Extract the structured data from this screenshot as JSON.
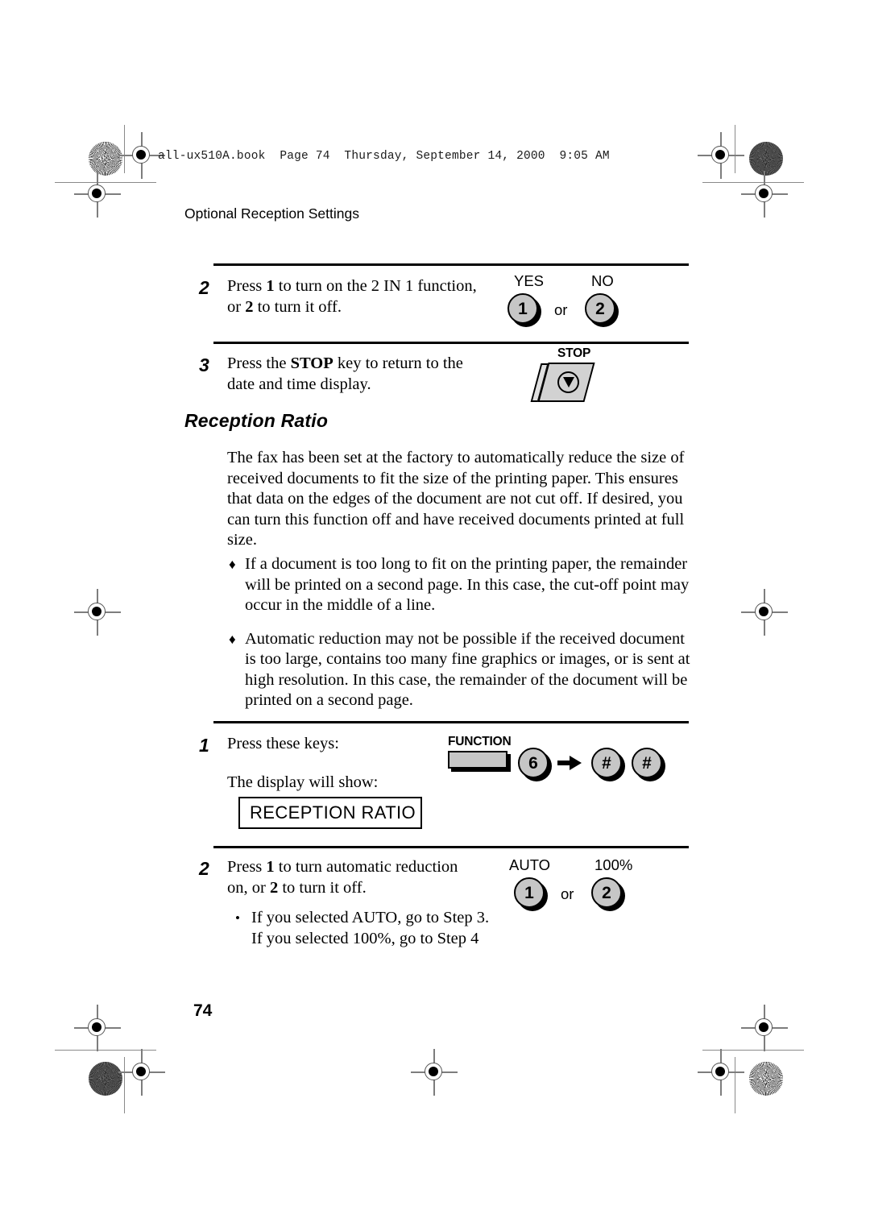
{
  "page": {
    "file_header": "all-ux510A.book  Page 74  Thursday, September 14, 2000  9:05 AM",
    "running_head": "Optional Reception Settings",
    "folio": "74",
    "colors": {
      "key_face": "#c6c6c6",
      "key_outline": "#000000",
      "rule": "#000000",
      "reg_mark": "#7d7d7d"
    }
  },
  "steps": {
    "two_in_one": {
      "number": "2",
      "line1_pre": "Press ",
      "line1_bold": "1",
      "line1_post": " to turn on the 2 IN 1 function,",
      "line2_pre": "or ",
      "line2_bold": "2",
      "line2_post": " to turn it off.",
      "key_label_left": "YES",
      "key_label_right": "NO",
      "key_left": "1",
      "key_right": "2",
      "or": "or"
    },
    "stop": {
      "number": "3",
      "line1_pre": "Press the ",
      "line1_bold": "STOP",
      "line1_post": " key to return to the",
      "line2": "date and time display.",
      "key_label": "STOP",
      "key_icon": "stop-triangle-icon"
    },
    "press_keys": {
      "number": "1",
      "line1": "Press these keys:",
      "line2": "The display will show:",
      "function_label": "FUNCTION",
      "key_six": "6",
      "arrow": "arrow-right-icon",
      "key_hash_1": "#",
      "key_hash_2": "#",
      "lcd_text": "RECEPTION RATIO"
    },
    "auto_reduction": {
      "number": "2",
      "line1_pre": "Press ",
      "line1_bold": "1",
      "line1_post": " to turn automatic reduction",
      "line2_pre": "on, or ",
      "line2_bold": "2",
      "line2_post": " to turn it off.",
      "key_label_left": "AUTO",
      "key_label_right": "100%",
      "key_left": "1",
      "key_right": "2",
      "or": "or",
      "note_bullet": "•",
      "note_line1": "If you selected AUTO, go to Step 3.",
      "note_line2": "If you selected 100%, go to Step 4"
    }
  },
  "section": {
    "heading": "Reception Ratio",
    "intro": "The fax has been set at the factory to automatically reduce the size of received documents to fit the size of the printing paper. This ensures that data on the edges of the document are not cut off. If desired, you can turn this function off and have received documents printed at full size.",
    "bullet_mark": "♦",
    "bullets": [
      "If a document is too long to fit on the printing paper, the remainder will be printed on a second page. In this case, the cut-off point may occur in the middle of a line.",
      "Automatic reduction may not be possible if the received document is too large, contains too many fine graphics or images, or is sent at high resolution. In this case, the remainder of the document will be printed on a second page."
    ]
  }
}
